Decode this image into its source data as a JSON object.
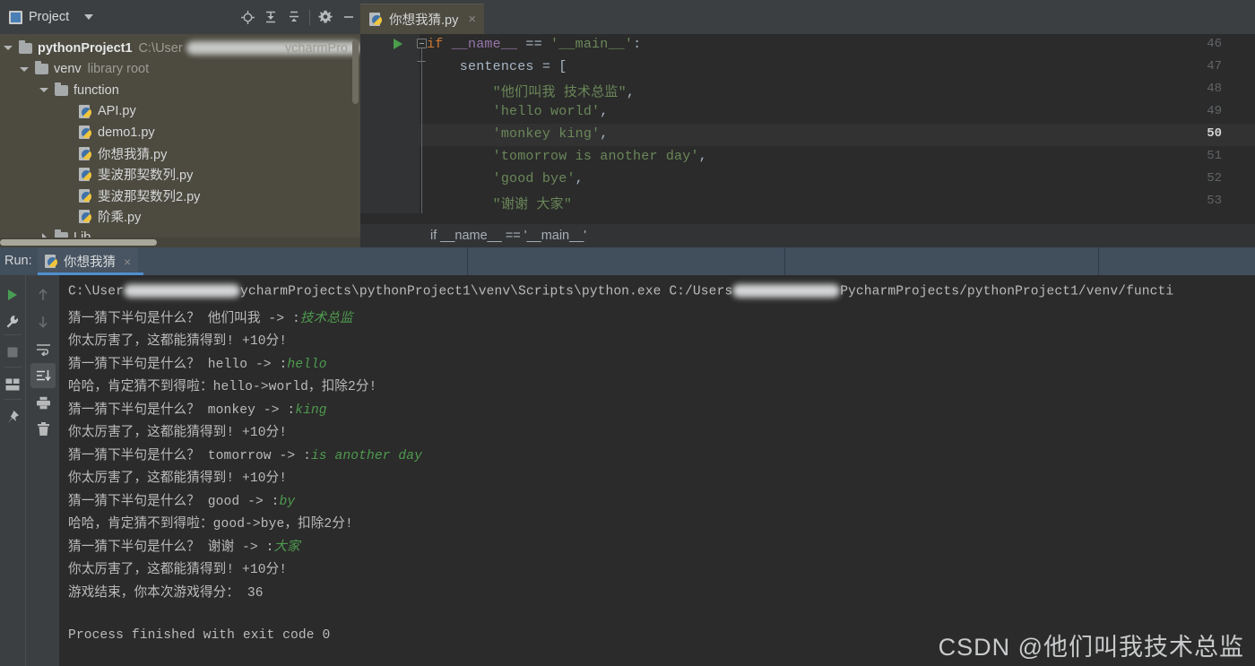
{
  "sidebar": {
    "title": "Project",
    "icons": [
      "project-icon",
      "chevron-down-icon",
      "locate-icon",
      "expand-all-icon",
      "collapse-all-icon",
      "settings-gear-icon",
      "minimize-icon"
    ],
    "tree": [
      {
        "label": "pythonProject1",
        "detail": "C:\\User",
        "detail_right": "ycharmPro",
        "kind": "folder",
        "depth": 0,
        "expanded": true,
        "bold": true
      },
      {
        "label": "venv",
        "detail": "library root",
        "kind": "folder",
        "depth": 1,
        "expanded": true,
        "bold": false
      },
      {
        "label": "function",
        "detail": "",
        "kind": "folder",
        "depth": 2,
        "expanded": true,
        "bold": false
      },
      {
        "label": "API.py",
        "detail": "",
        "kind": "python",
        "depth": 3,
        "expanded": false,
        "bold": false
      },
      {
        "label": "demo1.py",
        "detail": "",
        "kind": "python",
        "depth": 3,
        "expanded": false,
        "bold": false
      },
      {
        "label": "你想我猜.py",
        "detail": "",
        "kind": "python",
        "depth": 3,
        "expanded": false,
        "bold": false
      },
      {
        "label": "斐波那契数列.py",
        "detail": "",
        "kind": "python",
        "depth": 3,
        "expanded": false,
        "bold": false
      },
      {
        "label": "斐波那契数列2.py",
        "detail": "",
        "kind": "python",
        "depth": 3,
        "expanded": false,
        "bold": false
      },
      {
        "label": "阶乘.py",
        "detail": "",
        "kind": "python",
        "depth": 3,
        "expanded": false,
        "bold": false
      },
      {
        "label": "Lib",
        "detail": "",
        "kind": "folder",
        "depth": 2,
        "expanded": false,
        "bold": false
      }
    ]
  },
  "editor": {
    "tab": {
      "name": "你想我猜.py",
      "close": "×"
    },
    "breadcrumb": "if __name__ == '__main__'",
    "first_line_number": 46,
    "active_line_number": 50,
    "lines": [
      {
        "n": 46,
        "segs": [
          {
            "t": "if ",
            "c": "kw"
          },
          {
            "t": "__name__",
            "c": "id"
          },
          {
            "t": " == ",
            "c": "pl"
          },
          {
            "t": "'__main__'",
            "c": "str"
          },
          {
            "t": ":",
            "c": "pl"
          }
        ]
      },
      {
        "n": 47,
        "segs": [
          {
            "t": "    sentences = [",
            "c": "pl"
          }
        ]
      },
      {
        "n": 48,
        "segs": [
          {
            "t": "        ",
            "c": "pl"
          },
          {
            "t": "\"他们叫我 技术总监\"",
            "c": "str"
          },
          {
            "t": ",",
            "c": "pl"
          }
        ]
      },
      {
        "n": 49,
        "segs": [
          {
            "t": "        ",
            "c": "pl"
          },
          {
            "t": "'hello world'",
            "c": "str"
          },
          {
            "t": ",",
            "c": "pl"
          }
        ]
      },
      {
        "n": 50,
        "segs": [
          {
            "t": "        ",
            "c": "pl"
          },
          {
            "t": "'monkey king'",
            "c": "str"
          },
          {
            "t": ",",
            "c": "pl"
          }
        ]
      },
      {
        "n": 51,
        "segs": [
          {
            "t": "        ",
            "c": "pl"
          },
          {
            "t": "'tomorrow is another day'",
            "c": "str"
          },
          {
            "t": ",",
            "c": "pl"
          }
        ]
      },
      {
        "n": 52,
        "segs": [
          {
            "t": "        ",
            "c": "pl"
          },
          {
            "t": "'good bye'",
            "c": "str"
          },
          {
            "t": ",",
            "c": "pl"
          }
        ]
      },
      {
        "n": 53,
        "segs": [
          {
            "t": "        ",
            "c": "pl"
          },
          {
            "t": "\"谢谢 大家\"",
            "c": "str"
          }
        ]
      }
    ]
  },
  "run_panel": {
    "label": "Run:",
    "tab_name": "你想我猜",
    "tab_close": "×",
    "left_tools": [
      "rerun-icon",
      "wrench-icon",
      "stop-icon",
      "layout-icon",
      "pin-icon"
    ],
    "right_tools": [
      "up-arrow-icon",
      "down-arrow-icon",
      "soft-wrap-icon",
      "scroll-to-end-icon",
      "print-icon",
      "trash-icon"
    ],
    "console": [
      {
        "pre": "C:\\User",
        "redact": 120,
        "post": "ycharmProjects\\pythonProject1\\venv\\Scripts\\python.exe C:/Users",
        "redact2": 120,
        "post2": "PycharmProjects/pythonProject1/venv/functi"
      },
      {
        "text": "猜一猜下半句是什么？ 他们叫我 -> :",
        "green": "技术总监"
      },
      {
        "text": "你太厉害了，这都能猜得到! +10分!",
        "green": ""
      },
      {
        "text": "猜一猜下半句是什么？ hello -> :",
        "green": "hello"
      },
      {
        "text": "哈哈，肯定猜不到得啦：hello->world，扣除2分!",
        "green": ""
      },
      {
        "text": "猜一猜下半句是什么？ monkey -> :",
        "green": "king"
      },
      {
        "text": "你太厉害了，这都能猜得到! +10分!",
        "green": ""
      },
      {
        "text": "猜一猜下半句是什么？ tomorrow -> :",
        "green": "is another day"
      },
      {
        "text": "你太厉害了，这都能猜得到! +10分!",
        "green": ""
      },
      {
        "text": "猜一猜下半句是什么？ good -> :",
        "green": "by"
      },
      {
        "text": "哈哈，肯定猜不到得啦：good->bye，扣除2分!",
        "green": ""
      },
      {
        "text": "猜一猜下半句是什么？ 谢谢 -> :",
        "green": "大家"
      },
      {
        "text": "你太厉害了，这都能猜得到! +10分!",
        "green": ""
      },
      {
        "text": "游戏结束，你本次游戏得分： 36",
        "green": ""
      },
      {
        "text": "",
        "green": ""
      },
      {
        "text": "Process finished with exit code 0",
        "green": ""
      }
    ]
  },
  "watermark": "CSDN @他们叫我技术总监",
  "colors": {
    "sidebar_bg": "#4d4b40",
    "editor_bg": "#2b2b2b",
    "gutter_bg": "#313335",
    "chrome_bg": "#3c3f41",
    "run_header_bg": "#414e5c",
    "accent_blue": "#4f8fd0",
    "string_green": "#6a8759",
    "keyword_orange": "#cc7832",
    "console_green": "#4e9a4e"
  }
}
